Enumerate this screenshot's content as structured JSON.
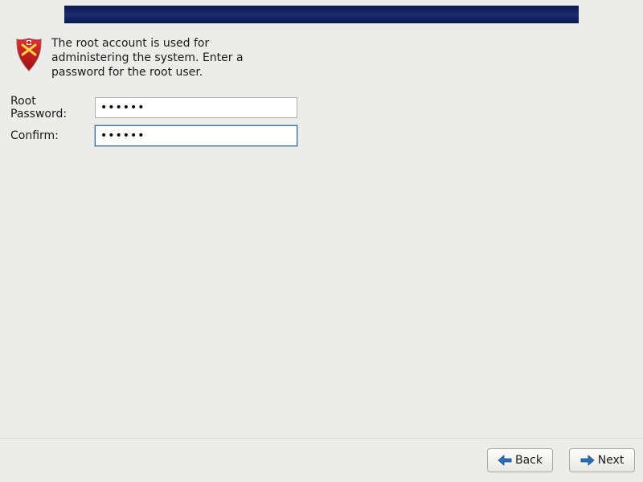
{
  "intro": {
    "text": "The root account is used for administering the system.  Enter a password for the root user."
  },
  "form": {
    "password_label": "Root Password:",
    "confirm_label": "Confirm:",
    "password_value": "••••••",
    "confirm_value": "••••••"
  },
  "footer": {
    "back_label": "Back",
    "next_label": "Next"
  }
}
